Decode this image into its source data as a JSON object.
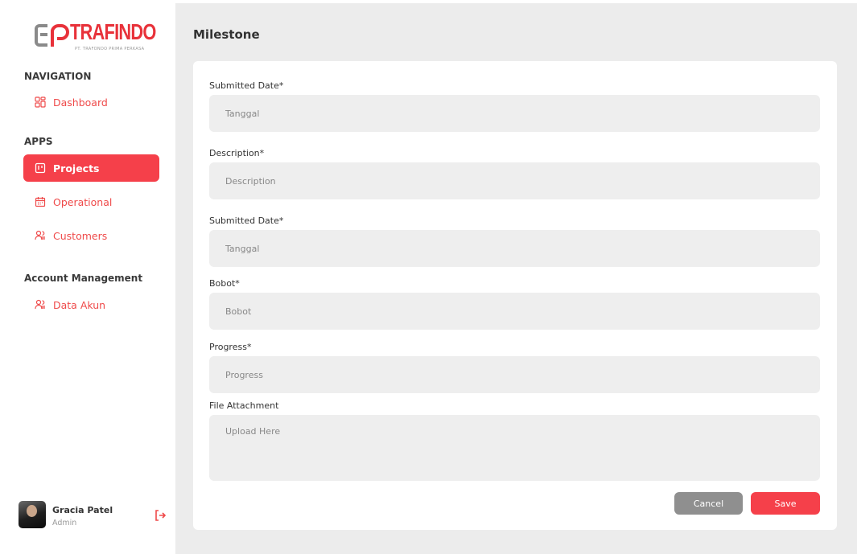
{
  "brand": {
    "name": "TRAFINDO",
    "subtitle": "PT. TRAFONDO PRIMA PERKASA",
    "color": "#e8323a"
  },
  "sidebar": {
    "sections": {
      "navigation": "NAVIGATION",
      "apps": "APPS",
      "account": "Account Management"
    },
    "items": [
      {
        "label": "Dashboard",
        "icon": "dashboard-icon",
        "active": false
      },
      {
        "label": "Projects",
        "icon": "projects-icon",
        "active": true
      },
      {
        "label": "Operational",
        "icon": "calendar-icon",
        "active": false
      },
      {
        "label": "Customers",
        "icon": "users-icon",
        "active": false
      },
      {
        "label": "Data Akun",
        "icon": "users-icon",
        "active": false
      }
    ]
  },
  "user": {
    "name": "Gracia Patel",
    "role": "Admin",
    "logout_icon": "logout-icon"
  },
  "page": {
    "title": "Milestone"
  },
  "form": {
    "fields": [
      {
        "label": "Submitted Date*",
        "placeholder": "Tanggal"
      },
      {
        "label": "Description*",
        "placeholder": "Description"
      },
      {
        "label": "Submitted Date*",
        "placeholder": "Tanggal"
      },
      {
        "label": "Bobot*",
        "placeholder": "Bobot"
      },
      {
        "label": "Progress*",
        "placeholder": "Progress"
      },
      {
        "label": "File Attachment",
        "placeholder": "Upload Here"
      }
    ],
    "cancel_label": "Cancel",
    "save_label": "Save"
  },
  "colors": {
    "accent": "#f5404a",
    "cancel": "#8f8f8f",
    "background": "#ececec"
  }
}
